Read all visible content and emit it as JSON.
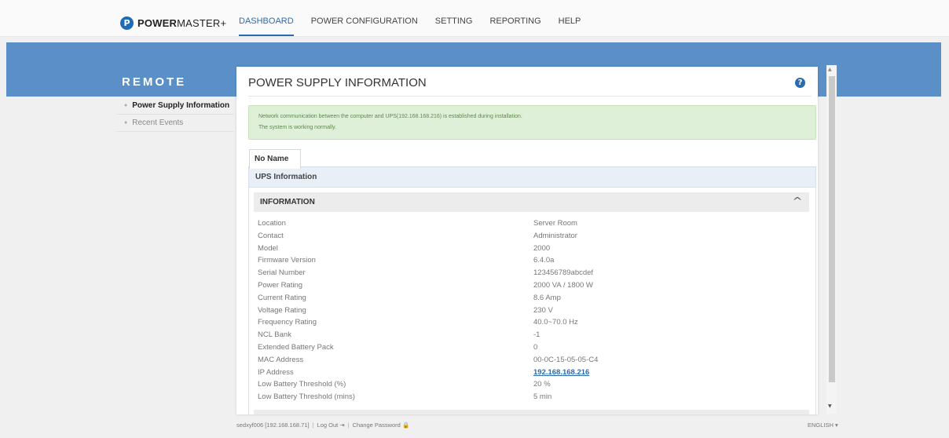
{
  "brand": {
    "mark": "P",
    "name_bold": "POWER",
    "name_rest": "MASTER+"
  },
  "nav": [
    {
      "label": "DASHBOARD"
    },
    {
      "label": "POWER CONFIGURATION"
    },
    {
      "label": "SETTING"
    },
    {
      "label": "REPORTING"
    },
    {
      "label": "HELP"
    }
  ],
  "section_title": "REMOTE",
  "sidebar": {
    "items": [
      {
        "label": "Power Supply Information"
      },
      {
        "label": "Recent Events"
      }
    ]
  },
  "panel": {
    "title": "POWER SUPPLY INFORMATION",
    "help_icon": "question-circle-icon",
    "alert": {
      "line1": "Network communication between the computer and UPS(192.168.168.216) is established during installation.",
      "line2": "The system is working normally."
    },
    "device_tab": "No Name",
    "ups_section": "UPS Information",
    "info_header": "INFORMATION",
    "collapse_icon": "chevron-up-icon",
    "rows": [
      {
        "label": "Location",
        "value": "Server Room"
      },
      {
        "label": "Contact",
        "value": "Administrator"
      },
      {
        "label": "Model",
        "value": "2000"
      },
      {
        "label": "Firmware Version",
        "value": "6.4.0a"
      },
      {
        "label": "Serial Number",
        "value": "123456789abcdef"
      },
      {
        "label": "Power Rating",
        "value": "2000 VA / 1800 W"
      },
      {
        "label": "Current Rating",
        "value": "8.6 Amp"
      },
      {
        "label": "Voltage Rating",
        "value": "230 V"
      },
      {
        "label": "Frequency Rating",
        "value": "40.0~70.0 Hz"
      },
      {
        "label": "NCL Bank",
        "value": "-1"
      },
      {
        "label": "Extended Battery Pack",
        "value": "0"
      },
      {
        "label": "MAC Address",
        "value": "00-0C-15-05-05-C4"
      },
      {
        "label": "IP Address",
        "value": "192.168.168.216"
      },
      {
        "label": "Low Battery Threshold (%)",
        "value": "20 %"
      },
      {
        "label": "Low Battery Threshold (mins)",
        "value": "5 min"
      }
    ]
  },
  "footer": {
    "user": "sedxyf006 [192.168.168.71]",
    "logout": "Log Out",
    "change_password": "Change Password",
    "language": "ENGLISH"
  },
  "colors": {
    "accent": "#2a6bb0",
    "band": "#5a8fc8",
    "alert_bg": "#dff0d8"
  }
}
